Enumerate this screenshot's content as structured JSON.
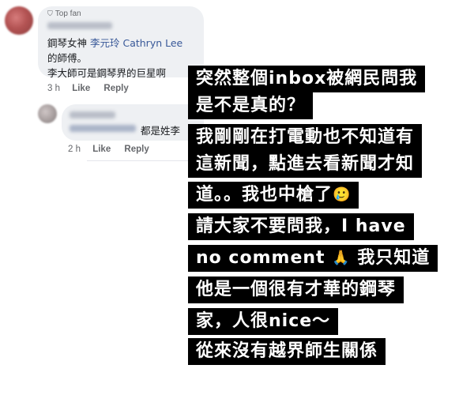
{
  "comment1": {
    "badge": "Top fan",
    "line1_prefix": "鋼琴女神",
    "mention": "李元玲 Cathryn Lee",
    "line2": "的師傅。",
    "line3": "李大師可是鋼琴界的巨星啊",
    "time": "3 h",
    "like": "Like",
    "reply": "Reply"
  },
  "comment2": {
    "text": "都是姓李",
    "time": "2 h",
    "like": "Like",
    "reply": "Reply"
  },
  "story": {
    "lines": [
      "突然整個inbox被網民問我",
      "是不是真的？",
      "我剛剛在打電動也不知道有",
      "這新聞，點進去看新聞才知",
      "道。。我也中槍了",
      "請大家不要問我，I have",
      "no comment",
      "他是一個很有才華的鋼琴",
      "家，人很nice～",
      "從來沒有越界師生關係"
    ],
    "line7_suffix": "我只知道",
    "emoji_crying": "🥲",
    "emoji_pray": "🙏"
  },
  "colors": {
    "overlay_bg": "#000000",
    "overlay_text": "#ffffff",
    "bubble": "#eef0f3",
    "mention": "#385898"
  }
}
